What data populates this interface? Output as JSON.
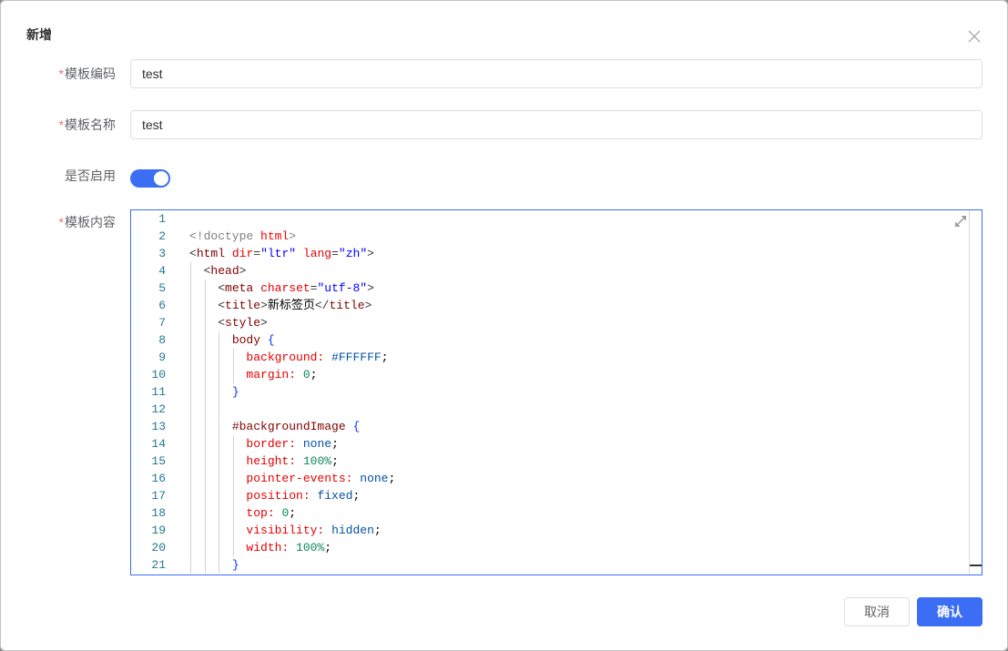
{
  "dialog": {
    "title": "新增",
    "close_icon": "close-icon"
  },
  "form": {
    "code": {
      "required_mark": "*",
      "label": "模板编码",
      "value": "test"
    },
    "name": {
      "required_mark": "*",
      "label": "模板名称",
      "value": "test"
    },
    "enabled": {
      "label": "是否启用",
      "on": true
    },
    "content": {
      "required_mark": "*",
      "label": "模板内容",
      "expand_icon": "expand-icon",
      "lines": [
        {
          "n": 1,
          "indent": 0,
          "tokens": []
        },
        {
          "n": 2,
          "indent": 0,
          "tokens": [
            [
              "<!doctype",
              "meta"
            ],
            [
              " ",
              "plain"
            ],
            [
              "html",
              "meta-content"
            ],
            [
              ">",
              "meta"
            ]
          ]
        },
        {
          "n": 3,
          "indent": 0,
          "tokens": [
            [
              "<",
              "delim"
            ],
            [
              "html",
              "tag"
            ],
            [
              " ",
              "plain"
            ],
            [
              "dir",
              "attr"
            ],
            [
              "=",
              "delim"
            ],
            [
              "\"ltr\"",
              "str"
            ],
            [
              " ",
              "plain"
            ],
            [
              "lang",
              "attr"
            ],
            [
              "=",
              "delim"
            ],
            [
              "\"zh\"",
              "str"
            ],
            [
              ">",
              "delim"
            ]
          ]
        },
        {
          "n": 4,
          "indent": 2,
          "tokens": [
            [
              "<",
              "delim"
            ],
            [
              "head",
              "tag"
            ],
            [
              ">",
              "delim"
            ]
          ]
        },
        {
          "n": 5,
          "indent": 4,
          "tokens": [
            [
              "<",
              "delim"
            ],
            [
              "meta",
              "tag"
            ],
            [
              " ",
              "plain"
            ],
            [
              "charset",
              "attr"
            ],
            [
              "=",
              "delim"
            ],
            [
              "\"utf-8\"",
              "str"
            ],
            [
              ">",
              "delim"
            ]
          ]
        },
        {
          "n": 6,
          "indent": 4,
          "tokens": [
            [
              "<",
              "delim"
            ],
            [
              "title",
              "tag"
            ],
            [
              ">",
              "delim"
            ],
            [
              "新标签页",
              "plain"
            ],
            [
              "</",
              "delim"
            ],
            [
              "title",
              "tag"
            ],
            [
              ">",
              "delim"
            ]
          ]
        },
        {
          "n": 7,
          "indent": 4,
          "tokens": [
            [
              "<",
              "delim"
            ],
            [
              "style",
              "tag"
            ],
            [
              ">",
              "delim"
            ]
          ]
        },
        {
          "n": 8,
          "indent": 6,
          "tokens": [
            [
              "body",
              "sel"
            ],
            [
              " ",
              "plain"
            ],
            [
              "{",
              "bracket"
            ]
          ]
        },
        {
          "n": 9,
          "indent": 8,
          "tokens": [
            [
              "background:",
              "prop"
            ],
            [
              " ",
              "plain"
            ],
            [
              "#FFFFFF",
              "val"
            ],
            [
              ";",
              "punct"
            ]
          ]
        },
        {
          "n": 10,
          "indent": 8,
          "tokens": [
            [
              "margin:",
              "prop"
            ],
            [
              " ",
              "plain"
            ],
            [
              "0",
              "num"
            ],
            [
              ";",
              "punct"
            ]
          ]
        },
        {
          "n": 11,
          "indent": 6,
          "tokens": [
            [
              "}",
              "bracket"
            ]
          ]
        },
        {
          "n": 12,
          "indent": 0,
          "tokens": []
        },
        {
          "n": 13,
          "indent": 6,
          "tokens": [
            [
              "#backgroundImage",
              "sel"
            ],
            [
              " ",
              "plain"
            ],
            [
              "{",
              "bracket"
            ]
          ]
        },
        {
          "n": 14,
          "indent": 8,
          "tokens": [
            [
              "border:",
              "prop"
            ],
            [
              " ",
              "plain"
            ],
            [
              "none",
              "val"
            ],
            [
              ";",
              "punct"
            ]
          ]
        },
        {
          "n": 15,
          "indent": 8,
          "tokens": [
            [
              "height:",
              "prop"
            ],
            [
              " ",
              "plain"
            ],
            [
              "100%",
              "num"
            ],
            [
              ";",
              "punct"
            ]
          ]
        },
        {
          "n": 16,
          "indent": 8,
          "tokens": [
            [
              "pointer-events:",
              "prop"
            ],
            [
              " ",
              "plain"
            ],
            [
              "none",
              "val"
            ],
            [
              ";",
              "punct"
            ]
          ]
        },
        {
          "n": 17,
          "indent": 8,
          "tokens": [
            [
              "position:",
              "prop"
            ],
            [
              " ",
              "plain"
            ],
            [
              "fixed",
              "val"
            ],
            [
              ";",
              "punct"
            ]
          ]
        },
        {
          "n": 18,
          "indent": 8,
          "tokens": [
            [
              "top:",
              "prop"
            ],
            [
              " ",
              "plain"
            ],
            [
              "0",
              "num"
            ],
            [
              ";",
              "punct"
            ]
          ]
        },
        {
          "n": 19,
          "indent": 8,
          "tokens": [
            [
              "visibility:",
              "prop"
            ],
            [
              " ",
              "plain"
            ],
            [
              "hidden",
              "val"
            ],
            [
              ";",
              "punct"
            ]
          ]
        },
        {
          "n": 20,
          "indent": 8,
          "tokens": [
            [
              "width:",
              "prop"
            ],
            [
              " ",
              "plain"
            ],
            [
              "100%",
              "num"
            ],
            [
              ";",
              "punct"
            ]
          ]
        },
        {
          "n": 21,
          "indent": 6,
          "tokens": [
            [
              "}",
              "bracket"
            ]
          ]
        }
      ]
    }
  },
  "footer": {
    "cancel_label": "取消",
    "confirm_label": "确认"
  },
  "colors": {
    "primary": "#3b6ef5",
    "required": "#f56c6c",
    "label": "#606266",
    "text": "#303133",
    "border": "#dcdfe6",
    "line_number": "#237893",
    "indent_guide": "#d3d3d3",
    "syntax": {
      "meta": "#808080",
      "meta-content": "#ff0000",
      "delim": "#383838",
      "tag": "#800000",
      "attr": "#e50000",
      "str": "#0000ff",
      "sel": "#800000",
      "prop": "#e50000",
      "val": "#0451a5",
      "num": "#098658",
      "bracket": "#0431fa",
      "punct": "#000000",
      "plain": "#000000"
    }
  }
}
